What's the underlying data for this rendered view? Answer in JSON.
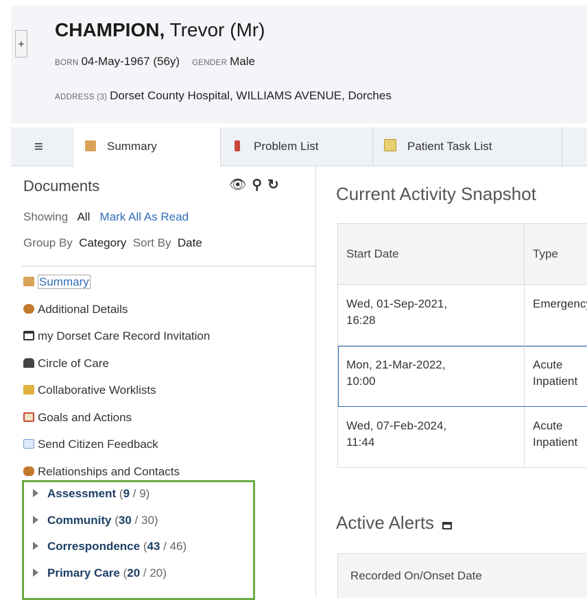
{
  "patient": {
    "surname": "CHAMPION,",
    "given": "Trevor (Mr)",
    "born_label": "BORN",
    "born_value": "04-May-1967 (56y)",
    "gender_label": "GENDER",
    "gender_value": "Male",
    "address_label": "ADDRESS (3)",
    "address_value": "Dorset County Hospital, WILLIAMS AVENUE, Dorches"
  },
  "header": {
    "expand_icon": "+"
  },
  "tabs": [
    {
      "label": "Summary",
      "icon": "summary-icon",
      "active": true
    },
    {
      "label": "Problem List",
      "icon": "thermometer-icon"
    },
    {
      "label": "Patient Task List",
      "icon": "task-icon"
    }
  ],
  "menu": {
    "icon": "≡"
  },
  "sidebar": {
    "title": "Documents",
    "tools": [
      "eye-icon",
      "search-icon",
      "refresh-icon"
    ],
    "showing_label": "Showing",
    "showing_value": "All",
    "mark_all": "Mark All As Read",
    "group_by_label": "Group By",
    "group_by_value": "Category",
    "sort_by_label": "Sort By",
    "sort_by_value": "Date",
    "items": [
      {
        "label": "Summary",
        "icon": "summary-icon",
        "color": "#d9a35a"
      },
      {
        "label": "Additional Details",
        "icon": "people-icon",
        "color": "#c2792c"
      },
      {
        "label": "my Dorset Care Record Invitation",
        "icon": "card-icon",
        "color": "#333333"
      },
      {
        "label": "Circle of Care",
        "icon": "group-icon",
        "color": "#444444"
      },
      {
        "label": "Collaborative Worklists",
        "icon": "worklist-icon",
        "color": "#e0b040"
      },
      {
        "label": "Goals and Actions",
        "icon": "goals-icon",
        "color": "#c8483a"
      },
      {
        "label": "Send Citizen Feedback",
        "icon": "envelope-icon",
        "color": "#7aa0d8"
      },
      {
        "label": "Relationships and Contacts",
        "icon": "contacts-icon",
        "color": "#c2792c"
      }
    ],
    "categories": [
      {
        "name": "Assessment",
        "unread": "9",
        "total": "9"
      },
      {
        "name": "Community",
        "unread": "30",
        "total": "30"
      },
      {
        "name": "Correspondence",
        "unread": "43",
        "total": "46"
      },
      {
        "name": "Primary Care",
        "unread": "20",
        "total": "20"
      }
    ]
  },
  "snapshot": {
    "title": "Current Activity Snapshot",
    "columns": [
      "Start Date",
      "Type"
    ],
    "rows": [
      {
        "start_line1": "Wed, 01-Sep-2021,",
        "start_line2": "16:28",
        "type_line1": "Emergency",
        "type_line2": ""
      },
      {
        "start_line1": "Mon, 21-Mar-2022,",
        "start_line2": "10:00",
        "type_line1": "Acute",
        "type_line2": "Inpatient"
      },
      {
        "start_line1": "Wed, 07-Feb-2024,",
        "start_line2": "11:44",
        "type_line1": "Acute",
        "type_line2": "Inpatient"
      }
    ]
  },
  "alerts": {
    "title": "Active Alerts",
    "column": "Recorded On/Onset Date"
  },
  "colors": {
    "accent": "#2f6db5",
    "highlight_box": "#6aaa45",
    "category_text": "#1e3f66"
  }
}
